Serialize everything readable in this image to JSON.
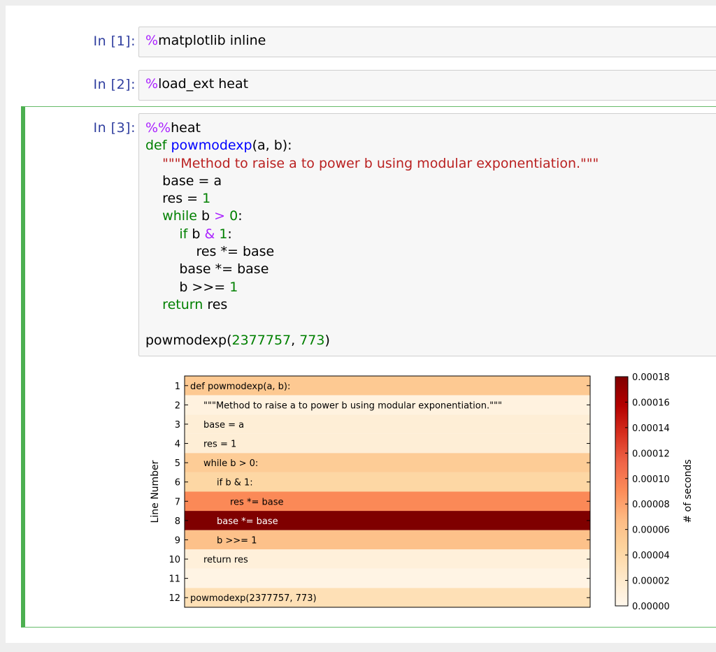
{
  "cells": [
    {
      "prompt": "In [1]:",
      "magic": "%",
      "code": "matplotlib inline"
    },
    {
      "prompt": "In [2]:",
      "magic": "%",
      "code": "load_ext heat"
    },
    {
      "prompt": "In [3]:"
    }
  ],
  "cell3": {
    "line1": {
      "magic": "%%",
      "text": "heat"
    },
    "line2": {
      "kw": "def",
      "fn": "powmodexp",
      "rest": "(a, b):"
    },
    "line3": {
      "indent": "    ",
      "str": "\"\"\"Method to raise a to power b using modular exponentiation.\"\"\""
    },
    "line4": {
      "text": "    base = a"
    },
    "line5": {
      "pre": "    res = ",
      "num": "1"
    },
    "line6": {
      "indent": "    ",
      "kw": "while",
      "mid": " b ",
      "op": ">",
      "sp": " ",
      "num": "0",
      "end": ":"
    },
    "line7": {
      "indent": "        ",
      "kw": "if",
      "mid": " b ",
      "op": "&",
      "sp": " ",
      "num": "1",
      "end": ":"
    },
    "line8": {
      "text": "            res *= base"
    },
    "line9": {
      "text": "        base *= base"
    },
    "line10": {
      "pre": "        b >>= ",
      "num": "1"
    },
    "line11": {
      "indent": "    ",
      "kw": "return",
      "rest": " res"
    },
    "line13": {
      "pre": "powmodexp(",
      "num1": "2377757",
      "sep": ", ",
      "num2": "773",
      "end": ")"
    }
  },
  "chart_data": {
    "type": "heatmap",
    "ylabel": "Line Number",
    "colorbar_label": "# of seconds",
    "colormap": "OrRd",
    "vmin": 0.0,
    "vmax": 0.00018,
    "colorbar_ticks": [
      "0.00000",
      "0.00002",
      "0.00004",
      "0.00006",
      "0.00008",
      "0.00010",
      "0.00012",
      "0.00014",
      "0.00016",
      "0.00018"
    ],
    "rows": [
      {
        "line": "1",
        "text": "def powmodexp(a, b):",
        "indent": 0,
        "value": 5.5e-05
      },
      {
        "line": "2",
        "text": "\"\"\"Method to raise a to power b using modular exponentiation.\"\"\"",
        "indent": 1,
        "value": 8e-06
      },
      {
        "line": "3",
        "text": "base = a",
        "indent": 1,
        "value": 1.4e-05
      },
      {
        "line": "4",
        "text": "res = 1",
        "indent": 1,
        "value": 1.4e-05
      },
      {
        "line": "5",
        "text": "while b > 0:",
        "indent": 1,
        "value": 5.2e-05
      },
      {
        "line": "6",
        "text": "if b & 1:",
        "indent": 2,
        "value": 4.2e-05
      },
      {
        "line": "7",
        "text": "res *= base",
        "indent": 3,
        "value": 9.2e-05
      },
      {
        "line": "8",
        "text": "base *= base",
        "indent": 2,
        "value": 0.00018
      },
      {
        "line": "9",
        "text": "b >>= 1",
        "indent": 2,
        "value": 6.2e-05
      },
      {
        "line": "10",
        "text": "return res",
        "indent": 1,
        "value": 1.1e-05
      },
      {
        "line": "11",
        "text": "",
        "indent": 0,
        "value": 5e-06
      },
      {
        "line": "12",
        "text": "powmodexp(2377757, 773)",
        "indent": 0,
        "value": 3.2e-05
      }
    ]
  }
}
